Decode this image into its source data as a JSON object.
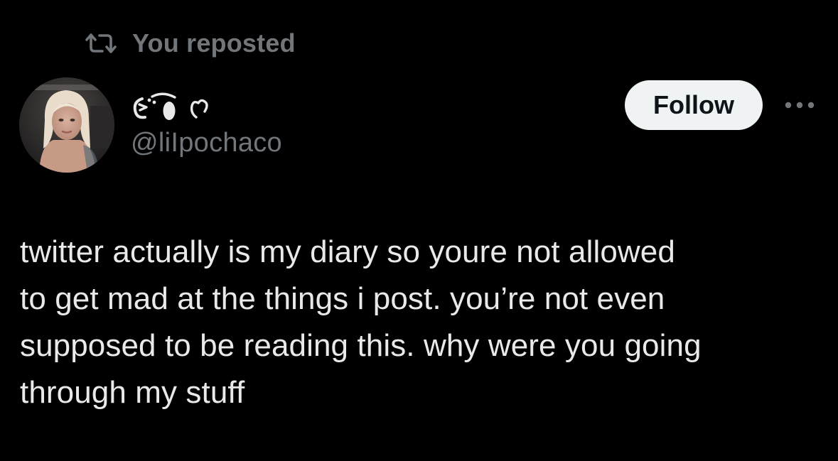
{
  "repost_banner": {
    "label": "You reposted",
    "icon": "repost-icon"
  },
  "author": {
    "display_name_emoji": "૮ ̊ ̊ა",
    "handle": "@liIpochaco",
    "avatar_icon": "avatar"
  },
  "actions": {
    "follow_label": "Follow",
    "more_icon": "more-icon"
  },
  "post": {
    "lines": [
      "twitter actually is my diary so youre not allowed",
      "to get mad at the things i post. you’re not even",
      "supposed to be reading this. why were you going",
      "through my stuff"
    ]
  },
  "colors": {
    "background": "#000000",
    "text": "#e7e9ea",
    "muted": "#71767b",
    "follow_bg": "#eff3f4",
    "follow_text": "#0f1419"
  }
}
